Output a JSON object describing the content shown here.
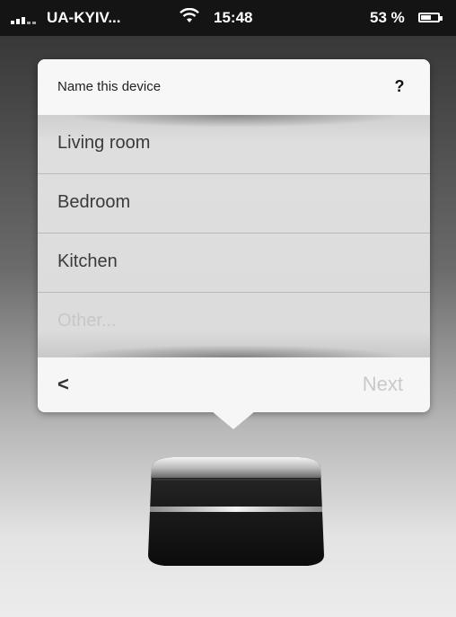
{
  "status_bar": {
    "carrier": "UA-KYIV...",
    "time": "15:48",
    "battery": "53 %"
  },
  "dialog": {
    "title": "Name this device",
    "help_label": "?",
    "options": [
      {
        "label": "Living room"
      },
      {
        "label": "Bedroom"
      },
      {
        "label": "Kitchen"
      }
    ],
    "other_placeholder": "Other...",
    "back_label": "<",
    "next_label": "Next"
  },
  "icons": {
    "signal": "signal-bars-icon",
    "wifi": "wifi-icon",
    "battery": "battery-icon",
    "device": "speaker-device"
  },
  "colors": {
    "next_disabled": "#c9c9c9",
    "placeholder": "#c7c7c7"
  }
}
